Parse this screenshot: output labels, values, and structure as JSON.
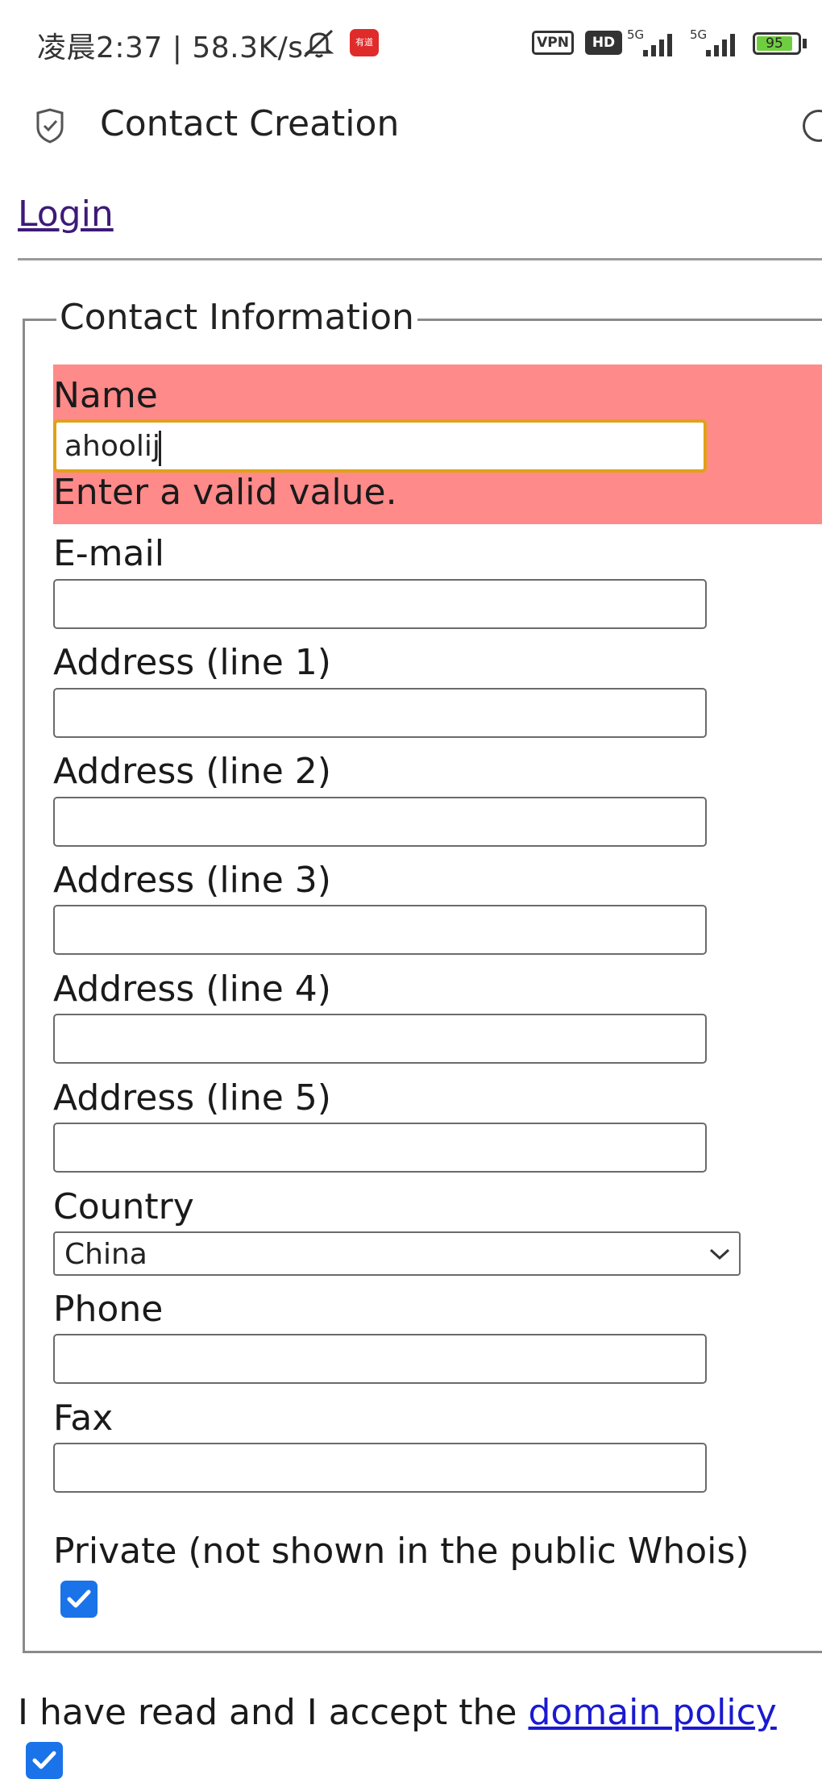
{
  "status_bar": {
    "time": "凌晨2:37 | 58.3K/s",
    "app_badge": "有道",
    "vpn": "VPN",
    "hd": "HD",
    "net1": "5G",
    "net2": "5G",
    "battery": "95"
  },
  "app_bar": {
    "title": "Contact Creation"
  },
  "nav": {
    "login": "Login"
  },
  "form": {
    "legend": "Contact Information",
    "name_label": "Name",
    "name_value": "ahoolij",
    "name_error": "Enter a valid value.",
    "email_label": "E-mail",
    "address1_label": "Address (line 1)",
    "address2_label": "Address (line 2)",
    "address3_label": "Address (line 3)",
    "address4_label": "Address (line 4)",
    "address5_label": "Address (line 5)",
    "country_label": "Country",
    "country_value": "China",
    "phone_label": "Phone",
    "fax_label": "Fax",
    "private_label": "Private (not shown in the public Whois)",
    "private_checked": true
  },
  "policy": {
    "text": "I have read and I accept the ",
    "link": "domain policy",
    "checked": true
  },
  "colors": {
    "error_bg": "#ff8a8a",
    "focus_border": "#e0a11a",
    "checkbox": "#1a73e8",
    "link": "#1a1ad0",
    "visited_link": "#3d1a78"
  }
}
